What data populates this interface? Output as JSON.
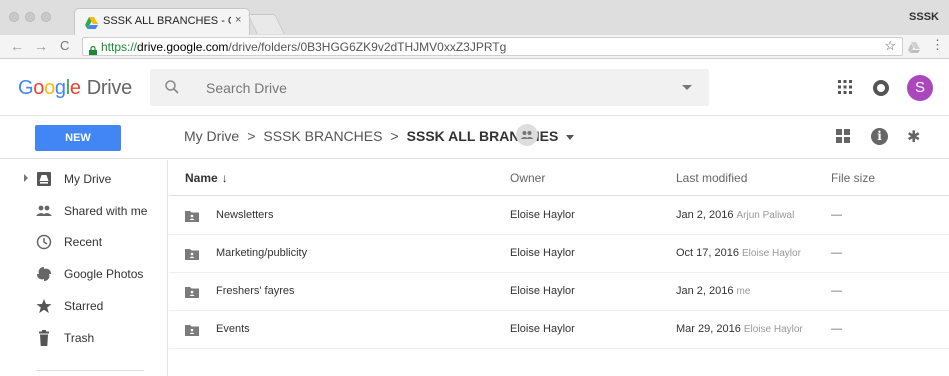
{
  "browser": {
    "tab_title": "SSSK ALL BRANCHES - Google Drive",
    "tab_close": "×",
    "profile_name": "SSSK",
    "url_scheme": "https://",
    "url_host": "drive.google.com",
    "url_path": "/drive/folders/0B3HGG6ZK9v2dTHJMV0xxZ3JPRTg",
    "nav": {
      "back": "←",
      "forward": "→",
      "reload": "C"
    },
    "star": "☆",
    "menu": "⋮"
  },
  "header": {
    "logo_letters": [
      "G",
      "o",
      "o",
      "g",
      "l",
      "e"
    ],
    "logo_word": "Drive",
    "search_placeholder": "Search Drive",
    "avatar_initial": "S"
  },
  "toolbar": {
    "new_label": "NEW",
    "breadcrumb": [
      "My Drive",
      "SSSK BRANCHES",
      "SSSK ALL BRANCHES"
    ],
    "breadcrumb_sep": ">",
    "info": "i",
    "settings": "✱"
  },
  "sidebar": {
    "items": [
      {
        "label": "My Drive",
        "icon": "drive-icon"
      },
      {
        "label": "Shared with me",
        "icon": "people-icon"
      },
      {
        "label": "Recent",
        "icon": "clock-icon"
      },
      {
        "label": "Google Photos",
        "icon": "photos-icon"
      },
      {
        "label": "Starred",
        "icon": "star-icon"
      },
      {
        "label": "Trash",
        "icon": "trash-icon"
      }
    ]
  },
  "table": {
    "columns": {
      "name": "Name",
      "sort_arrow": "↓",
      "owner": "Owner",
      "modified": "Last modified",
      "size": "File size"
    },
    "rows": [
      {
        "name": "Newsletters",
        "owner": "Eloise Haylor",
        "modified": "Jan 2, 2016",
        "modified_by": "Arjun Paliwal",
        "size": "—"
      },
      {
        "name": "Marketing/publicity",
        "owner": "Eloise Haylor",
        "modified": "Oct 17, 2016",
        "modified_by": "Eloise Haylor",
        "size": "—"
      },
      {
        "name": "Freshers' fayres",
        "owner": "Eloise Haylor",
        "modified": "Jan 2, 2016",
        "modified_by": "me",
        "size": "—"
      },
      {
        "name": "Events",
        "owner": "Eloise Haylor",
        "modified": "Mar 29, 2016",
        "modified_by": "Eloise Haylor",
        "size": "—"
      }
    ]
  },
  "colors": {
    "accent": "#4285f4",
    "avatar": "#ab47bc",
    "secure": "#1a8a34"
  }
}
